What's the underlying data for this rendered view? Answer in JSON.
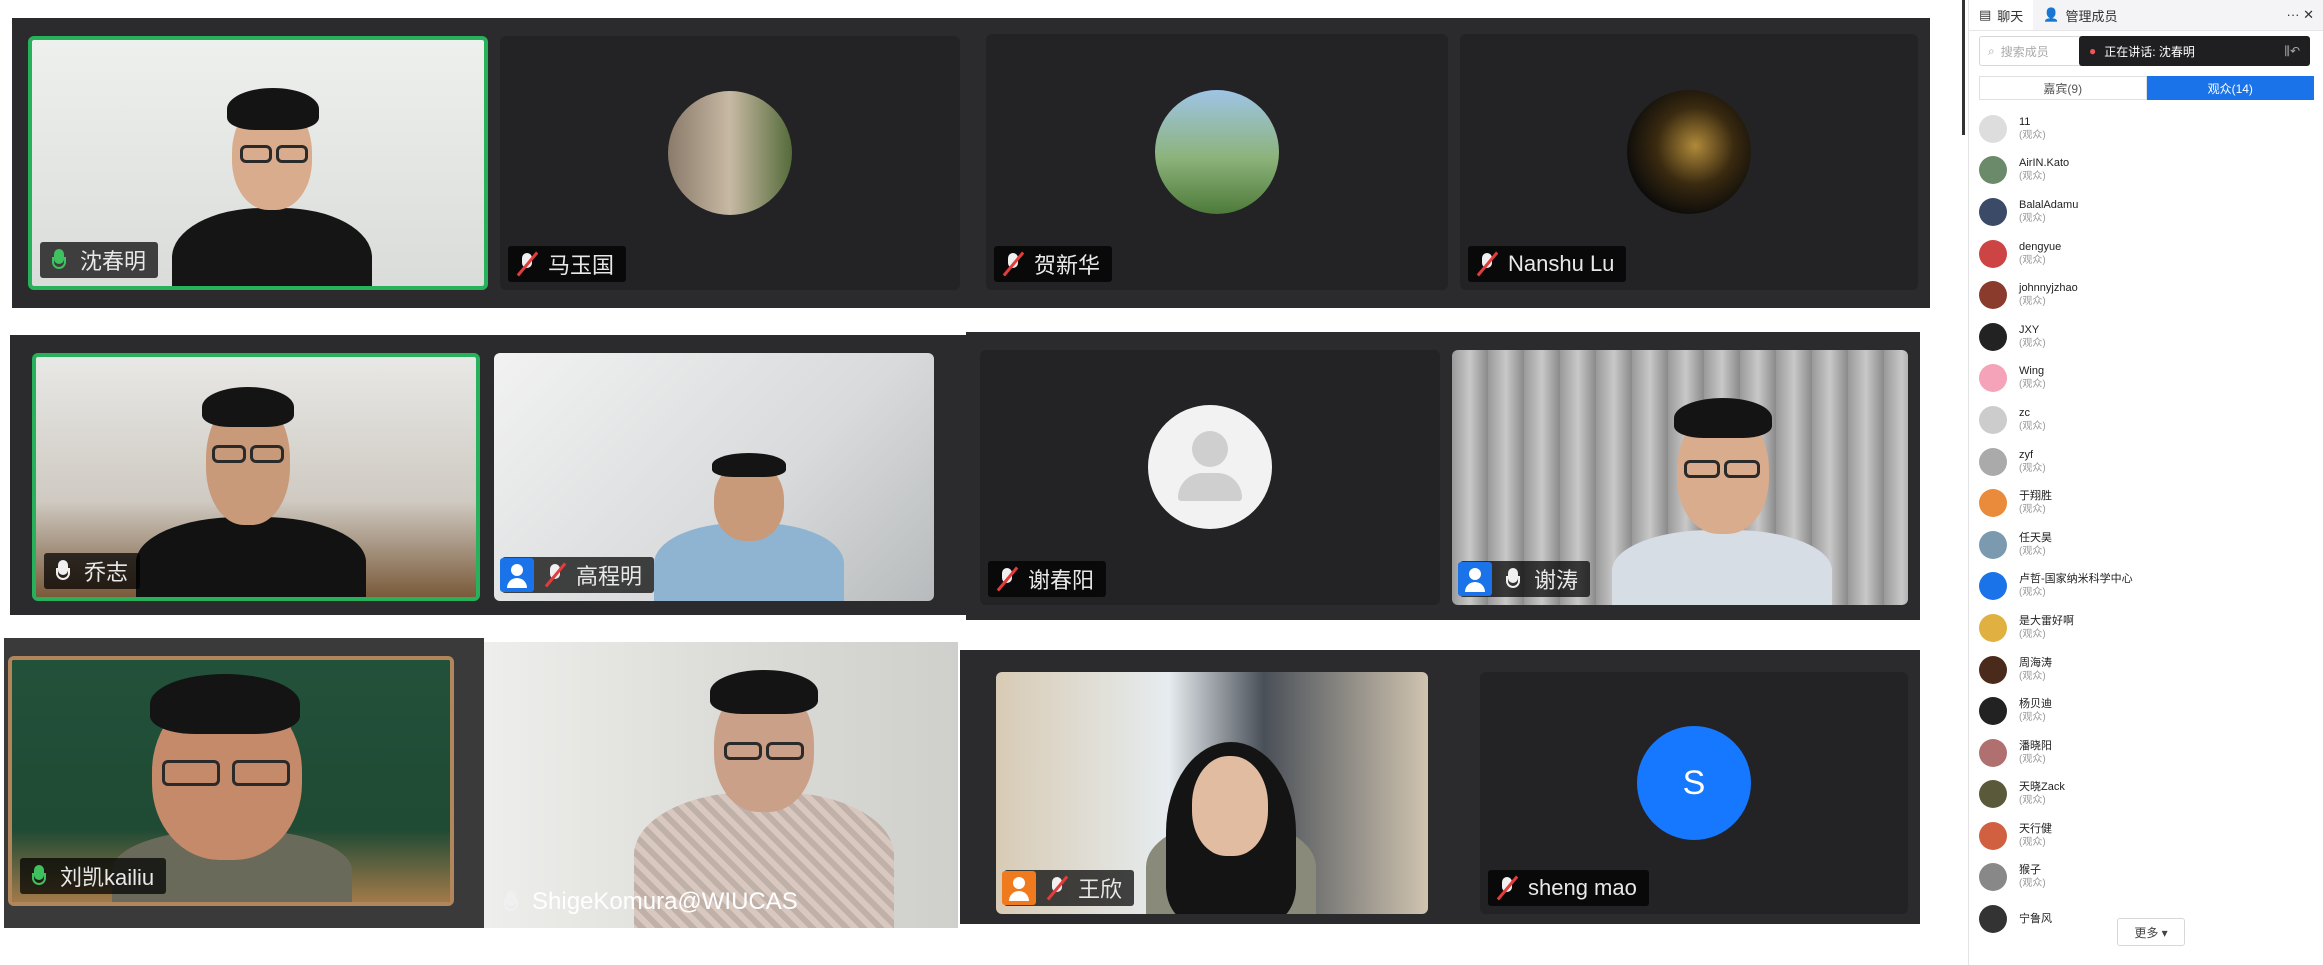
{
  "participants": {
    "r1": [
      {
        "name": "沈春明"
      },
      {
        "name": "马玉国"
      },
      {
        "name": "贺新华"
      },
      {
        "name": "Nanshu Lu"
      }
    ],
    "r2": [
      {
        "name": "乔志"
      },
      {
        "name": "高程明"
      },
      {
        "name": "谢春阳"
      },
      {
        "name": "谢涛"
      }
    ],
    "r3": [
      {
        "name": "刘凯kailiu"
      },
      {
        "name": "ShigeKomura@WIUCAS"
      },
      {
        "name": "王欣"
      },
      {
        "name": "sheng mao",
        "initial": "S"
      }
    ]
  },
  "sidebar": {
    "tab_chat": "聊天",
    "tab_members": "管理成员",
    "window_controls": "··· ✕",
    "search_placeholder": "搜索成员",
    "speaking_label": "正在讲话: 沈春明",
    "filter_host": "嘉宾(9)",
    "filter_audience": "观众(14)",
    "members": [
      {
        "name": "11",
        "role": "(观众)",
        "color": "#ddd"
      },
      {
        "name": "AirIN.Kato",
        "role": "(观众)",
        "color": "#6b8a6a"
      },
      {
        "name": "BalalAdamu",
        "role": "(观众)",
        "color": "#3b4a66"
      },
      {
        "name": "dengyue",
        "role": "(观众)",
        "color": "#c44"
      },
      {
        "name": "johnnyjzhao",
        "role": "(观众)",
        "color": "#8a3b2b"
      },
      {
        "name": "JXY",
        "role": "(观众)",
        "color": "#222"
      },
      {
        "name": "Wing",
        "role": "(观众)",
        "color": "#f5a3b8"
      },
      {
        "name": "zc",
        "role": "(观众)",
        "color": "#ccc"
      },
      {
        "name": "zyf",
        "role": "(观众)",
        "color": "#aaa"
      },
      {
        "name": "于翔胜",
        "role": "(观众)",
        "color": "#e98b3a"
      },
      {
        "name": "任天昊",
        "role": "(观众)",
        "color": "#7b9ab0"
      },
      {
        "name": "卢哲-国家纳米科学中心",
        "role": "(观众)",
        "color": "#1a73e8"
      },
      {
        "name": "是大雷好啊",
        "role": "(观众)",
        "color": "#e0b040"
      },
      {
        "name": "周海涛",
        "role": "(观众)",
        "color": "#4a2a1a"
      },
      {
        "name": "杨贝迪",
        "role": "(观众)",
        "color": "#222"
      },
      {
        "name": "潘晓阳",
        "role": "(观众)",
        "color": "#b07070"
      },
      {
        "name": "天晓Zack",
        "role": "(观众)",
        "color": "#5a5a3a"
      },
      {
        "name": "天行健",
        "role": "(观众)",
        "color": "#d06040"
      },
      {
        "name": "猴子",
        "role": "(观众)",
        "color": "#888"
      },
      {
        "name": "宁鲁风",
        "role": "",
        "color": "#333"
      }
    ],
    "more_label": "更多 ▾"
  }
}
